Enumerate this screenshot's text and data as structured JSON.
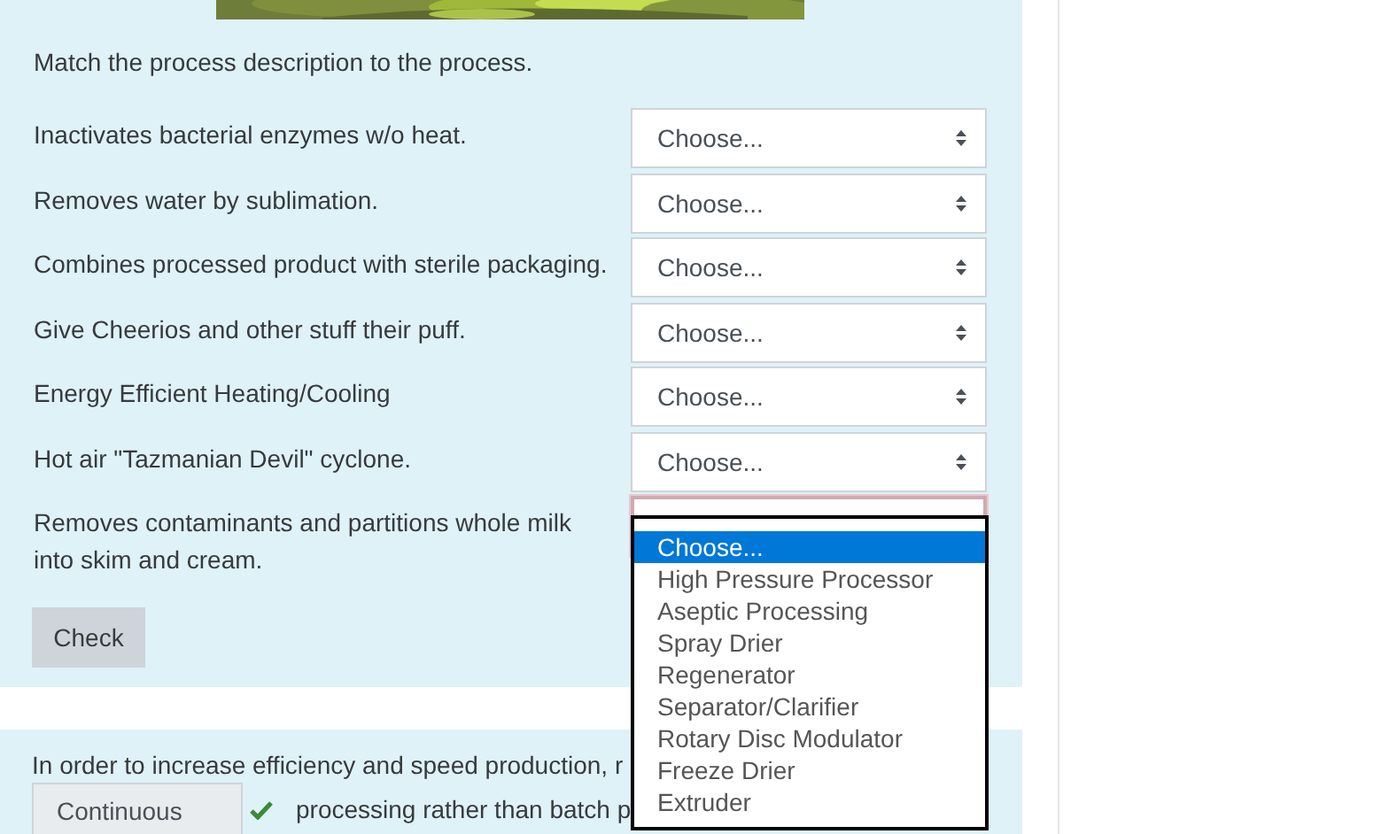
{
  "question_1": {
    "prompt": "Match the process description to the process.",
    "rows": [
      {
        "text": "Inactivates bacterial enzymes w/o heat.",
        "value": "Choose...",
        "focused": false
      },
      {
        "text": "Removes water by sublimation.",
        "value": "Choose...",
        "focused": false
      },
      {
        "text": "Combines processed product with sterile packaging.",
        "value": "Choose...",
        "focused": false
      },
      {
        "text": "Give Cheerios and other stuff their puff.",
        "value": "Choose...",
        "focused": false
      },
      {
        "text": "Energy Efficient Heating/Cooling",
        "value": "Choose...",
        "focused": false
      },
      {
        "text": "Hot air \"Tazmanian Devil\" cyclone.",
        "value": "Choose...",
        "focused": false
      },
      {
        "text": "Removes contaminants and partitions whole milk into skim and cream.",
        "focused": true
      }
    ],
    "check_button": "Check"
  },
  "question_2": {
    "text_before": "In order to increase efficiency and speed production, r",
    "answer": "Continuous",
    "correct": true,
    "text_after": "processing rather than batch p"
  },
  "open_dropdown": {
    "options": [
      {
        "label": "Choose...",
        "selected": true
      },
      {
        "label": "High Pressure Processor",
        "selected": false
      },
      {
        "label": "Aseptic Processing",
        "selected": false
      },
      {
        "label": "Spray Drier",
        "selected": false
      },
      {
        "label": "Regenerator",
        "selected": false
      },
      {
        "label": "Separator/Clarifier",
        "selected": false
      },
      {
        "label": "Rotary Disc Modulator",
        "selected": false
      },
      {
        "label": "Freeze Drier",
        "selected": false
      },
      {
        "label": "Extruder",
        "selected": false
      }
    ]
  }
}
